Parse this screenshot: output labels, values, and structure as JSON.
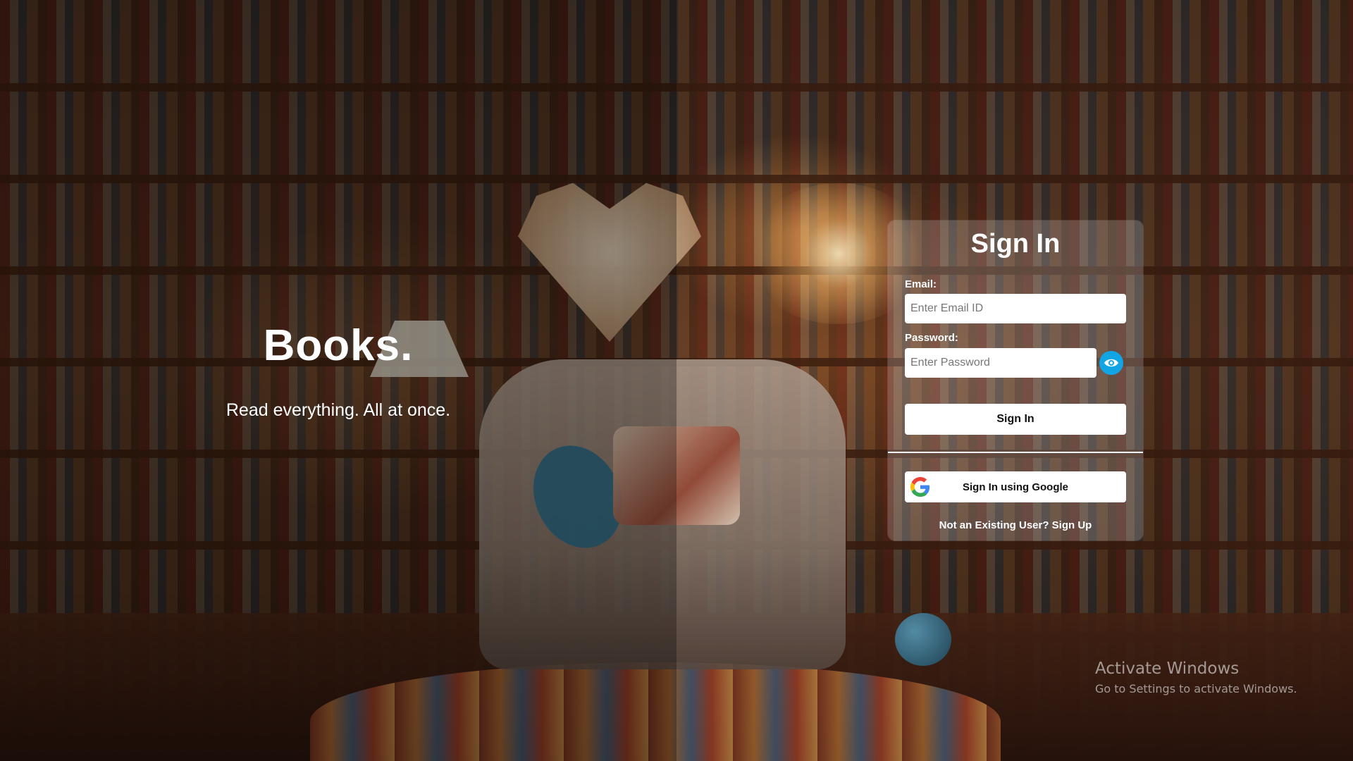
{
  "hero": {
    "title": "Books.",
    "tagline": "Read everything. All at once."
  },
  "signin_card": {
    "title": "Sign In",
    "email": {
      "label": "Email:",
      "value": "",
      "placeholder": "Enter Email ID"
    },
    "password": {
      "label": "Password:",
      "value": "",
      "placeholder": "Enter Password"
    },
    "toggle_password_icon": "eye-icon",
    "signin_button_label": "Sign In",
    "google_button_label": "Sign In using Google",
    "google_icon": "google-logo-icon",
    "signup_prompt": "Not an Existing User?",
    "signup_link_label": "Sign Up"
  },
  "watermark": {
    "title": "Activate Windows",
    "subtitle": "Go to Settings to activate Windows."
  },
  "colors": {
    "accent_eye_button": "#12a5e6",
    "button_background": "#ffffff",
    "text_on_dark": "#ffffff"
  }
}
